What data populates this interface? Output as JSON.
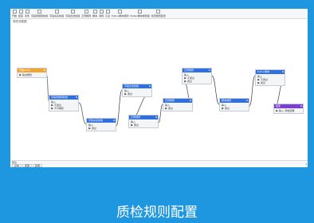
{
  "toolbar": {
    "buttons": [
      {
        "label": "开始",
        "icon": "start-icon"
      },
      {
        "label": "结束",
        "icon": "end-icon"
      },
      {
        "label": "条件",
        "icon": "condition-icon"
      },
      {
        "label": "字段值规则校验",
        "icon": "field-rule-icon"
      },
      {
        "label": "字段关系校验",
        "icon": "relation-rule-icon"
      },
      {
        "label": "字段合法校验",
        "icon": "legal-rule-icon"
      },
      {
        "label": "正则规则",
        "icon": "regex-icon"
      },
      {
        "label": "脚本",
        "icon": "script-icon"
      },
      {
        "label": "调用",
        "icon": "call-icon"
      },
      {
        "label": "汇总",
        "icon": "summary-icon"
      },
      {
        "label": "Python脚本规则",
        "icon": "python-icon"
      },
      {
        "label": "Python脚本规则组",
        "icon": "python-group-icon"
      },
      {
        "label": "检查规则配置",
        "icon": "check-config-icon"
      }
    ]
  },
  "breadcrumb": "规则流程图",
  "nodes": [
    {
      "id": "n1",
      "title": "开始(start)",
      "variant": "start",
      "rows": [
        "▶ 输出规则"
      ]
    },
    {
      "id": "n2",
      "title": "字段值规则校验",
      "variant": "normal",
      "rows": [
        "输入",
        "▶ 不通过",
        "▶ 不可审核"
      ]
    },
    {
      "id": "n3",
      "title": "字段关系校验",
      "variant": "normal",
      "rows": [
        "输入",
        "▶ 通过"
      ]
    },
    {
      "id": "n4",
      "title": "字段合法校验",
      "variant": "normal",
      "rows": [
        "输入",
        "▶ 通过"
      ]
    },
    {
      "id": "n5",
      "title": "正则规则",
      "variant": "normal",
      "rows": [
        "输入",
        "▶ 通过"
      ]
    },
    {
      "id": "n6",
      "title": "正则规则",
      "variant": "normal",
      "rows": [
        "输入",
        "▶ 通过"
      ]
    },
    {
      "id": "n7",
      "title": "正则规则",
      "variant": "normal",
      "rows": [
        "输入",
        "▶ 不通过",
        "▶ 通过"
      ]
    },
    {
      "id": "n8",
      "title": "脚本规则",
      "variant": "normal",
      "rows": [
        "输入",
        "▶ 通过"
      ]
    },
    {
      "id": "n9",
      "title": "Python脚本",
      "variant": "normal",
      "rows": [
        "输入",
        "▶ 不通过",
        "▶ 通过"
      ]
    },
    {
      "id": "n10",
      "title": "结束",
      "variant": "end",
      "rows": [
        "▶ 输入: 质检结果"
      ]
    }
  ],
  "bottom": {
    "title": "属性",
    "tabs": [
      "基本",
      "变量",
      "结果"
    ]
  },
  "caption": "质检规则配置",
  "colors": {
    "background": "#1e96e0",
    "node_header": "#2f6fe0",
    "start_header": "#f0a531",
    "end_header": "#7b3fd3"
  }
}
